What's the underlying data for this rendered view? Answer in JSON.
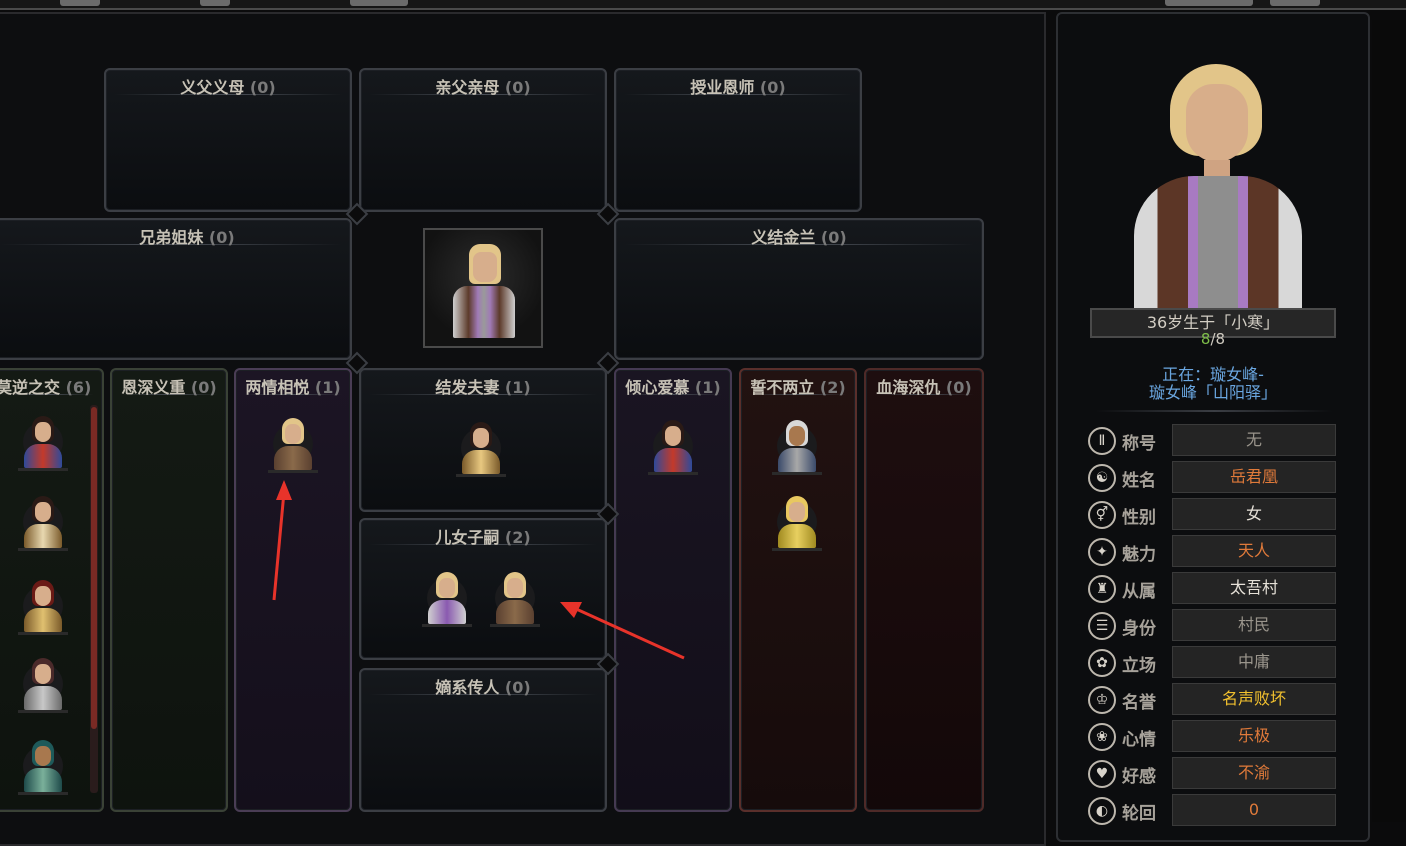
{
  "colors": {
    "accent_blue": "#6aa6e0",
    "value_orange": "#e07a3a",
    "value_yellow": "#f2c12e",
    "value_white": "#e6e1d8",
    "value_grey": "#9a958c",
    "hp_green": "#7fbf4a"
  },
  "relations": {
    "adoptive_parents": {
      "label": "义父义母",
      "count": "(0)"
    },
    "birth_parents": {
      "label": "亲父亲母",
      "count": "(0)"
    },
    "mentor": {
      "label": "授业恩师",
      "count": "(0)"
    },
    "siblings": {
      "label": "兄弟姐妹",
      "count": "(0)"
    },
    "sworn_siblings": {
      "label": "义结金兰",
      "count": "(0)"
    },
    "close_friends": {
      "label": "莫逆之交",
      "count": "(6)"
    },
    "benefactors": {
      "label": "恩深义重",
      "count": "(0)"
    },
    "lovers": {
      "label": "两情相悦",
      "count": "(1)"
    },
    "spouse": {
      "label": "结发夫妻",
      "count": "(1)"
    },
    "children": {
      "label": "儿女子嗣",
      "count": "(2)"
    },
    "disciples": {
      "label": "嫡系传人",
      "count": "(0)"
    },
    "admirers": {
      "label": "倾心爱慕",
      "count": "(1)"
    },
    "enemies": {
      "label": "誓不两立",
      "count": "(2)"
    },
    "blood_feud": {
      "label": "血海深仇",
      "count": "(0)"
    }
  },
  "character": {
    "age_birth": "36岁生于「小寒」",
    "hp_current": "8",
    "hp_sep": "/",
    "hp_max": "8",
    "location_line1": "正在：璇女峰-",
    "location_line2": "璇女峰「山阳驿」"
  },
  "attributes": [
    {
      "icon": "title-icon",
      "glyph": "Ⅱ",
      "label": "称号",
      "value": "无",
      "color": "#9a958c"
    },
    {
      "icon": "name-icon",
      "glyph": "☯",
      "label": "姓名",
      "value": "岳君凰",
      "color": "#e07a3a"
    },
    {
      "icon": "gender-icon",
      "glyph": "⚥",
      "label": "性别",
      "value": "女",
      "color": "#e6e1d8"
    },
    {
      "icon": "charm-icon",
      "glyph": "✦",
      "label": "魅力",
      "value": "天人",
      "color": "#e07a3a"
    },
    {
      "icon": "faction-icon",
      "glyph": "♜",
      "label": "从属",
      "value": "太吾村",
      "color": "#e6e1d8"
    },
    {
      "icon": "identity-icon",
      "glyph": "☰",
      "label": "身份",
      "value": "村民",
      "color": "#9a958c"
    },
    {
      "icon": "stance-icon",
      "glyph": "✿",
      "label": "立场",
      "value": "中庸",
      "color": "#9a958c"
    },
    {
      "icon": "reputation-icon",
      "glyph": "♔",
      "label": "名誉",
      "value": "名声败坏",
      "color": "#f2c12e"
    },
    {
      "icon": "mood-icon",
      "glyph": "❀",
      "label": "心情",
      "value": "乐极",
      "color": "#e07a3a"
    },
    {
      "icon": "favor-icon",
      "glyph": "♥",
      "label": "好感",
      "value": "不渝",
      "color": "#e07a3a"
    },
    {
      "icon": "rebirth-icon",
      "glyph": "◐",
      "label": "轮回",
      "value": "0",
      "color": "#e07a3a"
    }
  ]
}
